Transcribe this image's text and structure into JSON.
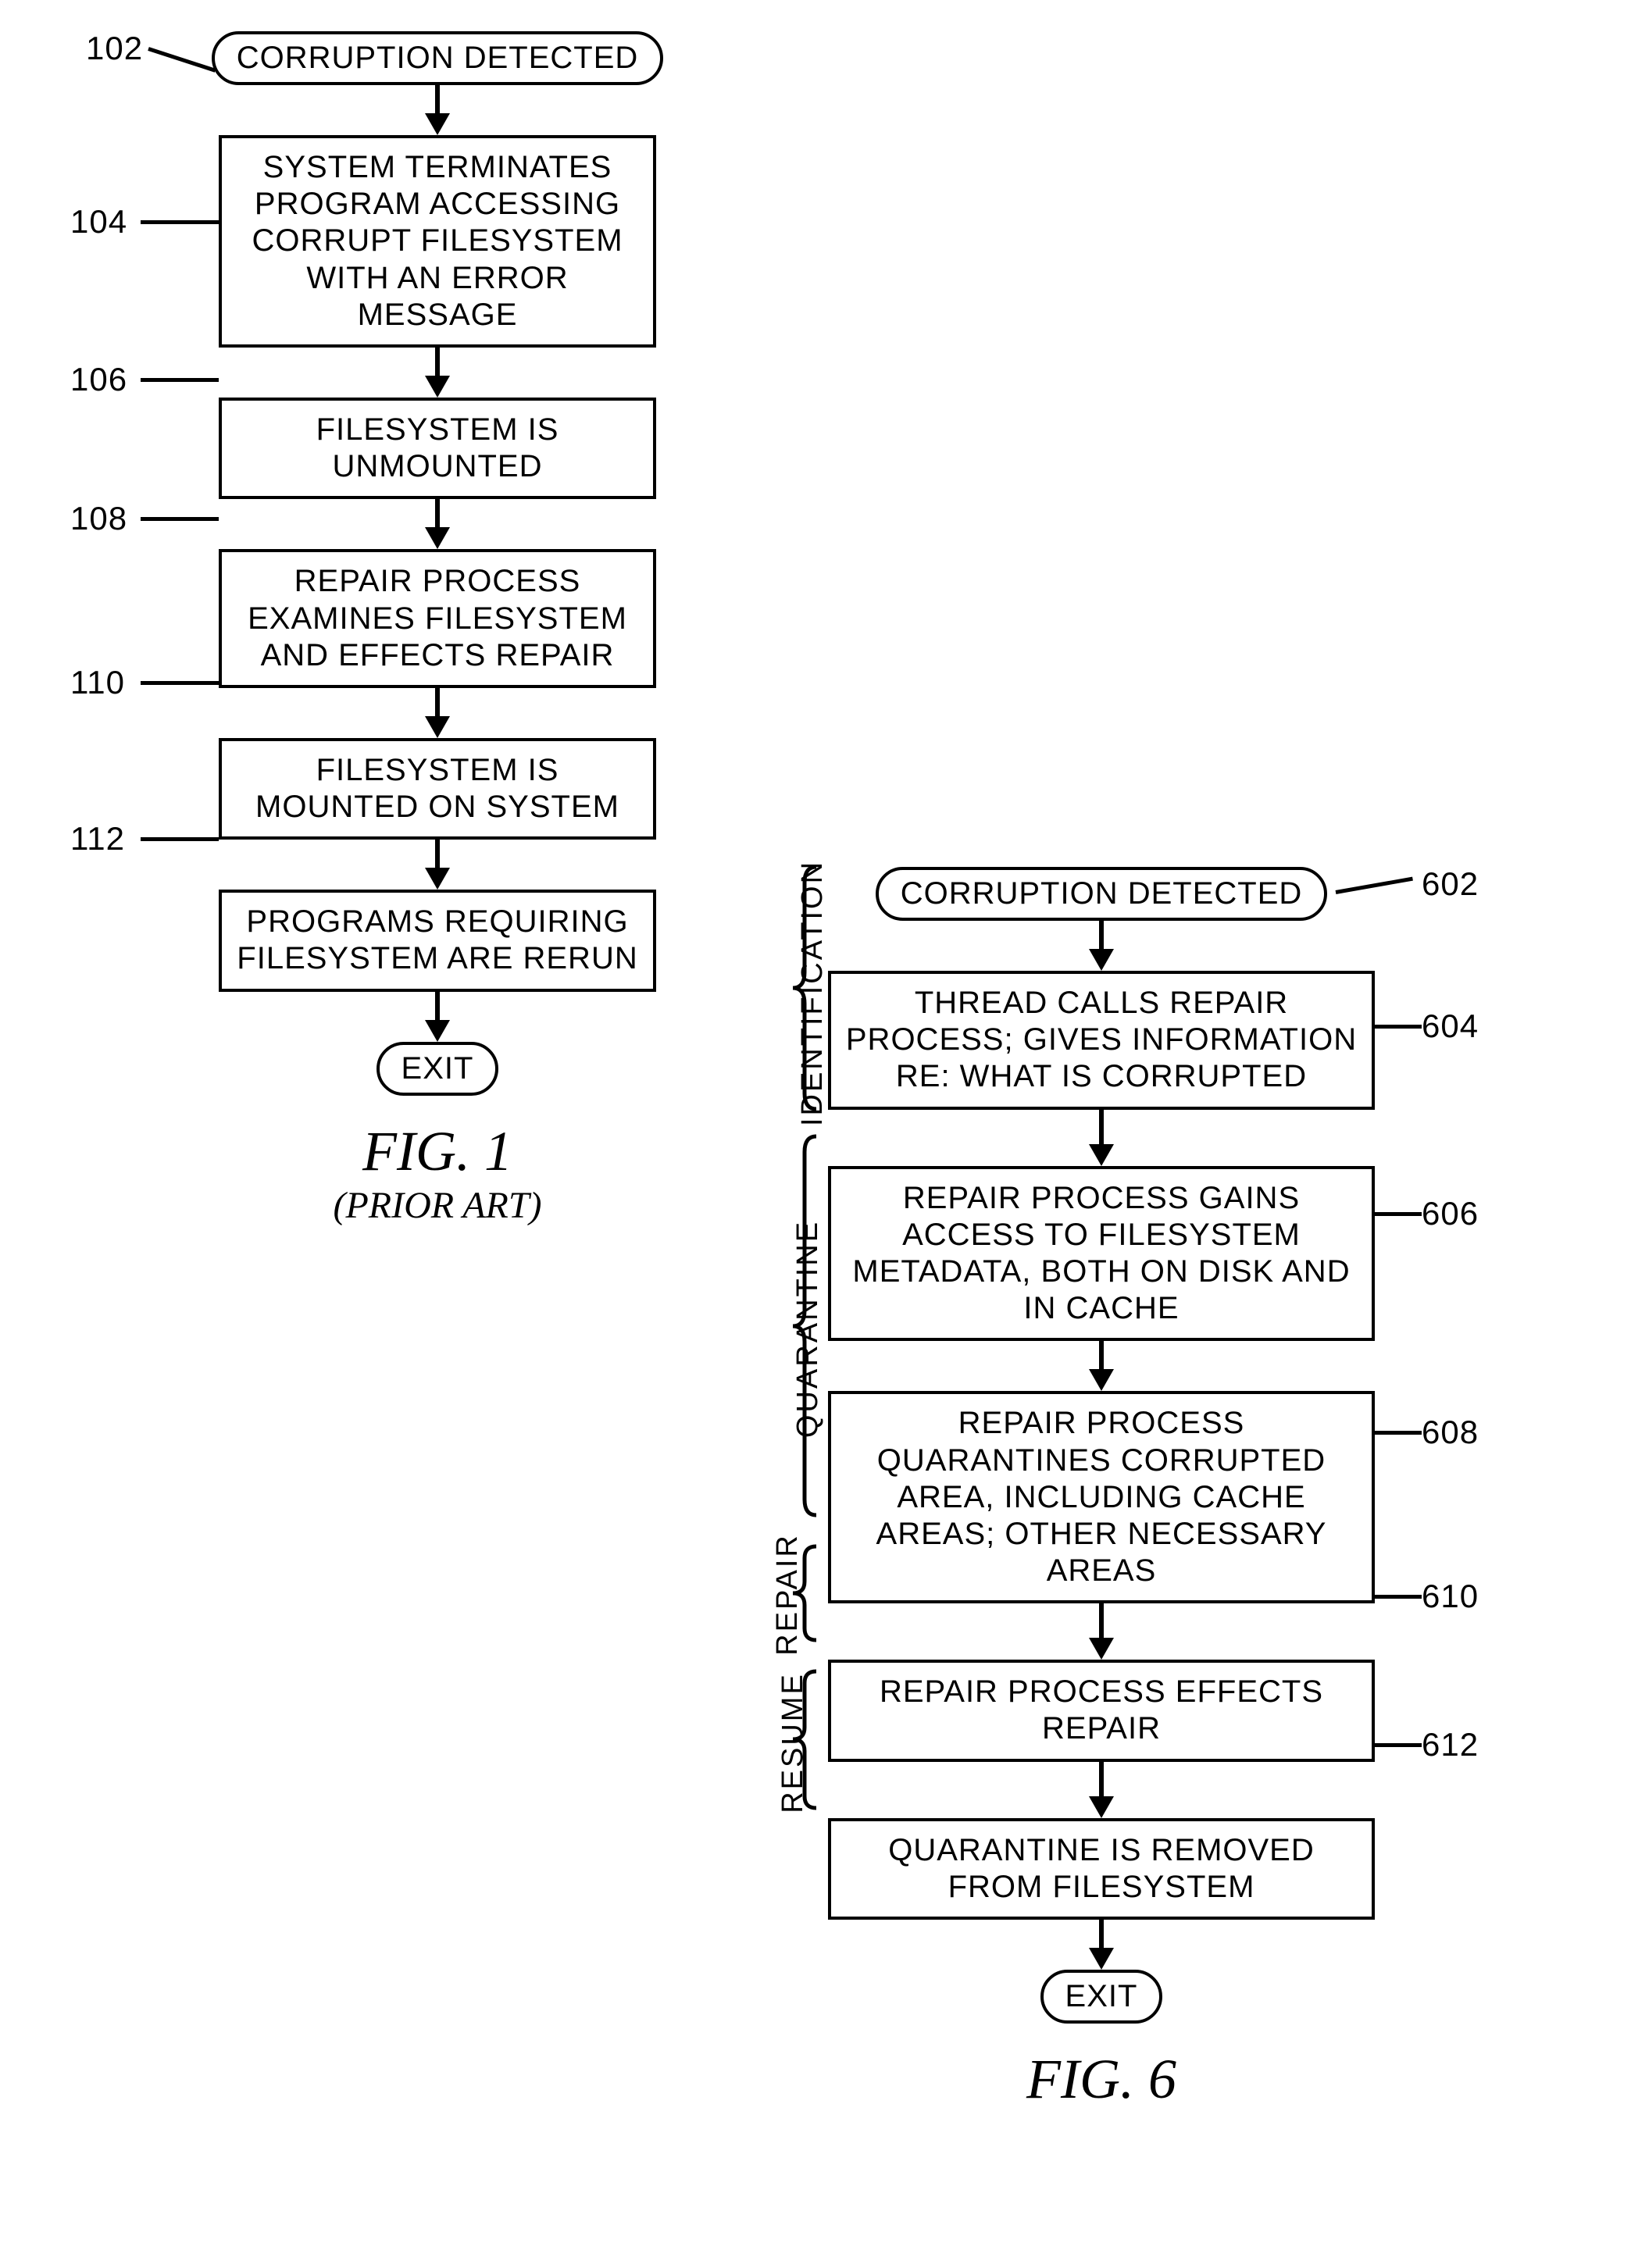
{
  "fig1": {
    "caption": "FIG. 1",
    "sub": "(PRIOR ART)",
    "refs": {
      "r102": "102",
      "r104": "104",
      "r106": "106",
      "r108": "108",
      "r110": "110",
      "r112": "112"
    },
    "start": "CORRUPTION DETECTED",
    "s104": "SYSTEM TERMINATES PROGRAM ACCESSING CORRUPT FILESYSTEM WITH AN ERROR MESSAGE",
    "s106": "FILESYSTEM IS UNMOUNTED",
    "s108": "REPAIR PROCESS EXAMINES FILESYSTEM AND EFFECTS REPAIR",
    "s110": "FILESYSTEM IS MOUNTED ON SYSTEM",
    "s112": "PROGRAMS REQUIRING FILESYSTEM ARE RERUN",
    "exit": "EXIT"
  },
  "fig6": {
    "caption": "FIG. 6",
    "refs": {
      "r602": "602",
      "r604": "604",
      "r606": "606",
      "r608": "608",
      "r610": "610",
      "r612": "612"
    },
    "phases": {
      "id": "IDENTIFICATION",
      "q": "QUARANTINE",
      "rep": "REPAIR",
      "res": "RESUME"
    },
    "start": "CORRUPTION DETECTED",
    "s604": "THREAD CALLS REPAIR PROCESS; GIVES INFORMATION RE: WHAT IS CORRUPTED",
    "s606": "REPAIR PROCESS GAINS ACCESS TO FILESYSTEM METADATA, BOTH ON DISK AND IN CACHE",
    "s608": "REPAIR PROCESS QUARANTINES CORRUPTED AREA, INCLUDING CACHE AREAS; OTHER NECESSARY AREAS",
    "s610": "REPAIR PROCESS EFFECTS REPAIR",
    "s612": "QUARANTINE IS REMOVED FROM FILESYSTEM",
    "exit": "EXIT"
  }
}
